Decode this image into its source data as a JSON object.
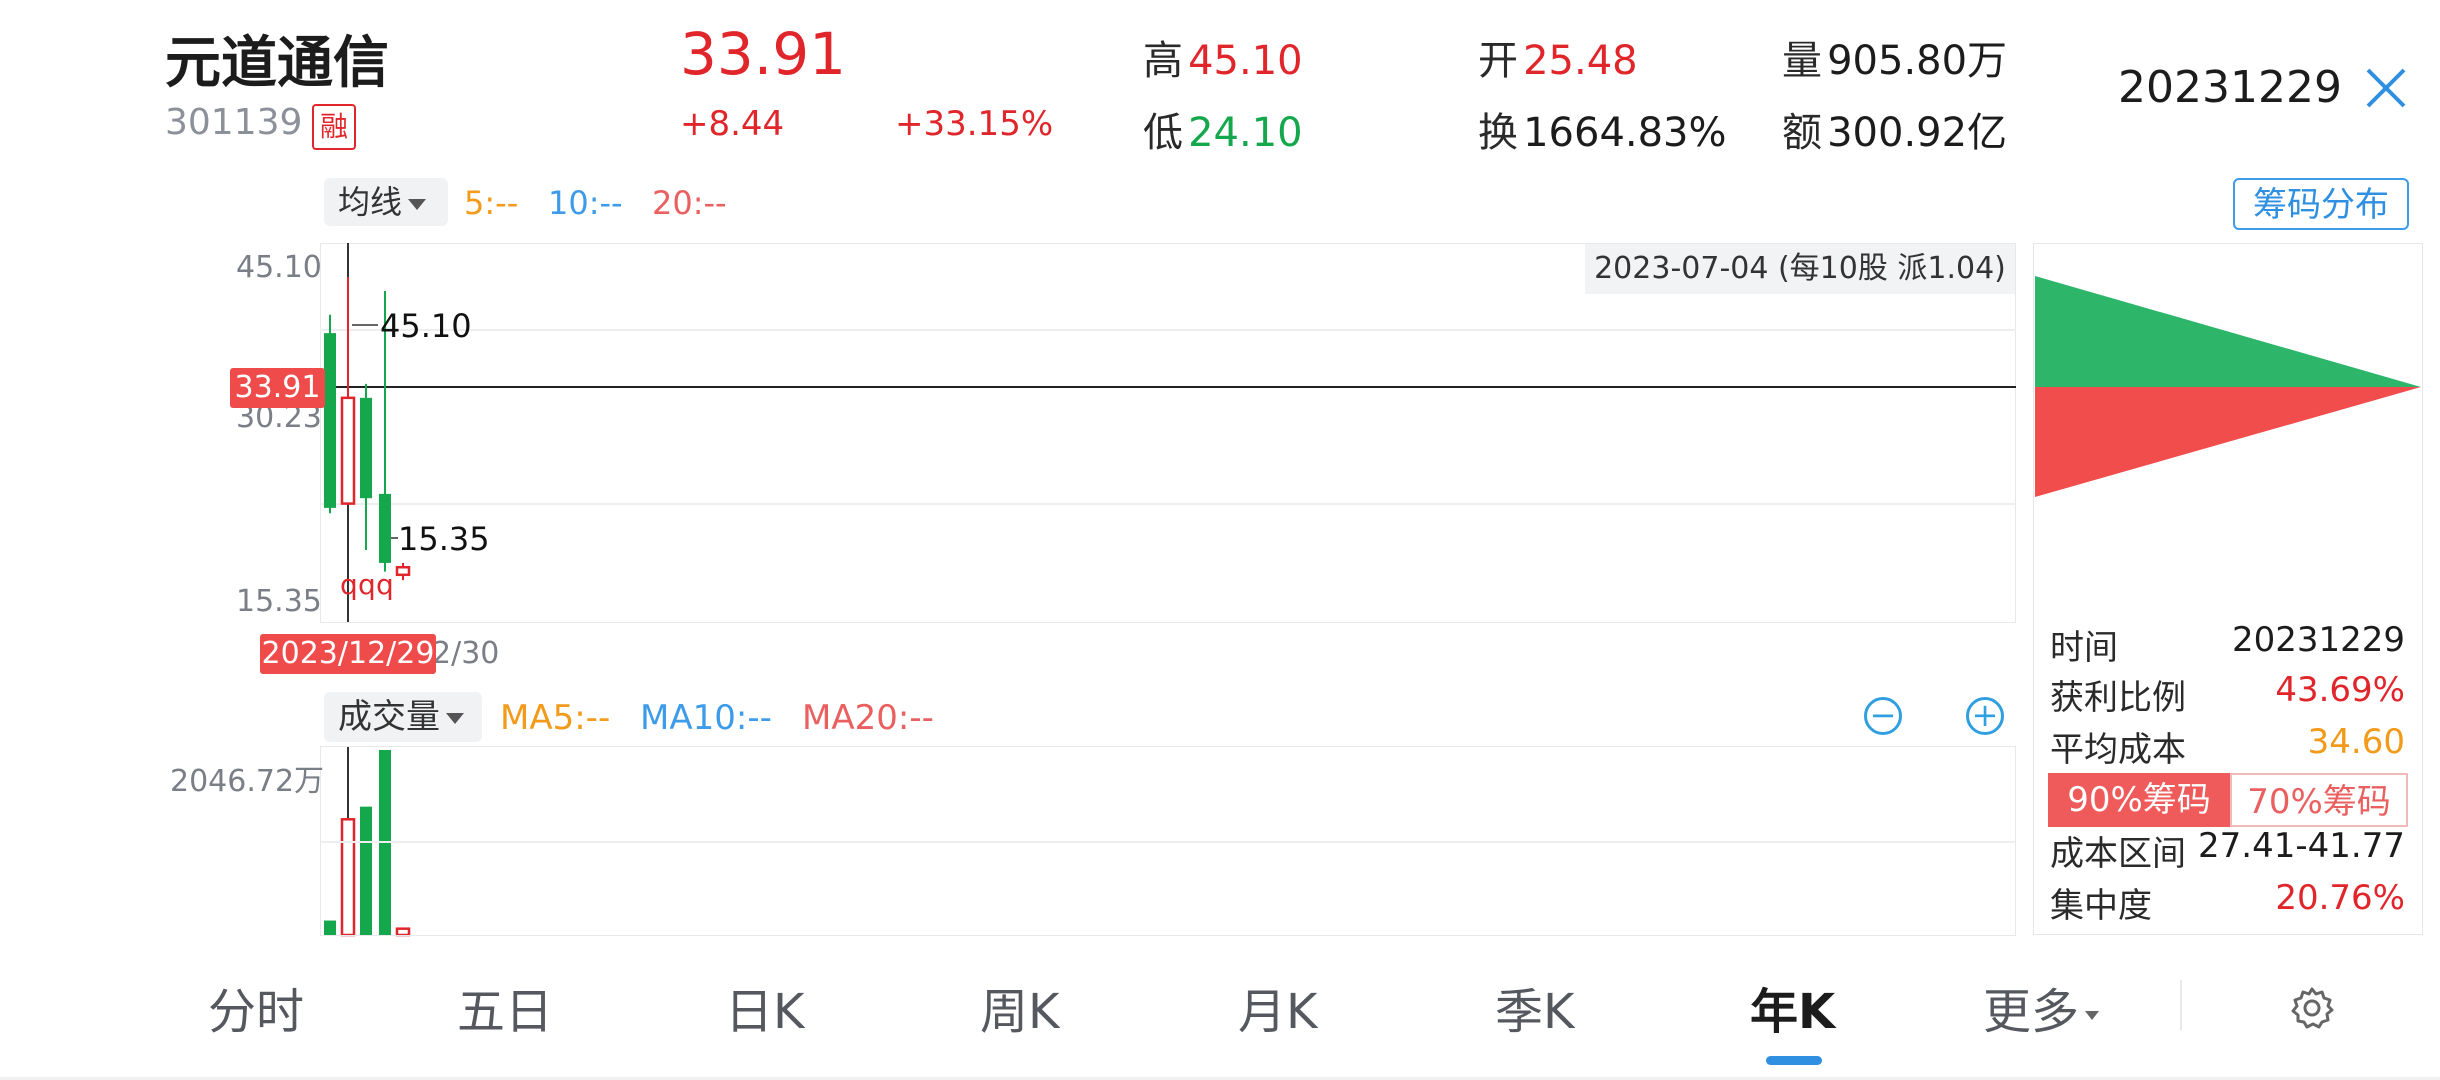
{
  "header": {
    "name": "元道通信",
    "code": "301139",
    "badge": "融",
    "price": "33.91",
    "change": "+8.44",
    "change_pct": "+33.15%",
    "high_label": "高",
    "high": "45.10",
    "low_label": "低",
    "low": "24.10",
    "open_label": "开",
    "open": "25.48",
    "turnover_label": "换",
    "turnover": "1664.83%",
    "volume_label": "量",
    "volume": "905.80万",
    "amount_label": "额",
    "amount": "300.92亿",
    "date": "20231229"
  },
  "ma_bar": {
    "selector": "均线",
    "ma5": "5:--",
    "ma10": "10:--",
    "ma20": "20:--",
    "chip_button": "筹码分布"
  },
  "main_chart": {
    "y_high": "45.10",
    "y_mid": "30.23",
    "y_low": "15.35",
    "current_price_tag": "33.91",
    "high_annotation": "45.10",
    "low_annotation": "15.35",
    "dividend_tag": "2023-07-04 (每10股 派1.04)",
    "event_marks": [
      "q",
      "q",
      "q"
    ],
    "crosshair_date": "2023/12/29",
    "x_label_partial": "2/30"
  },
  "volume_bar": {
    "selector": "成交量",
    "ma5": "MA5:--",
    "ma10": "MA10:--",
    "ma20": "MA20:--",
    "max_label": "2046.72万",
    "zoom_out": "−",
    "zoom_in": "+"
  },
  "chip_panel": {
    "time_label": "时间",
    "time_value": "20231229",
    "profit_label": "获利比例",
    "profit_value": "43.69%",
    "avg_cost_label": "平均成本",
    "avg_cost_value": "34.60",
    "tab_90": "90%筹码",
    "tab_70": "70%筹码",
    "range_label": "成本区间",
    "range_value": "27.41-41.77",
    "concentration_label": "集中度",
    "concentration_value": "20.76%"
  },
  "bottom_nav": {
    "items": [
      "分时",
      "五日",
      "日K",
      "周K",
      "月K",
      "季K",
      "年K",
      "更多"
    ],
    "active": "年K"
  },
  "chart_data": {
    "type": "candlestick",
    "candles": [
      {
        "open": 23.7,
        "close": 39.9,
        "high": 41.6,
        "low": 23.2,
        "color": "green"
      },
      {
        "open": 24.1,
        "close": 33.9,
        "high": 45.1,
        "low": 24.1,
        "color": "red"
      },
      {
        "open": 33.9,
        "close": 24.6,
        "high": 35.2,
        "low": 19.8,
        "color": "green"
      },
      {
        "open": 25.0,
        "close": 18.6,
        "high": 43.8,
        "low": 17.8,
        "color": "green"
      },
      {
        "open": 17.5,
        "close": 18.2,
        "high": 18.6,
        "low": 17.0,
        "color": "red"
      }
    ],
    "volumes_wan": [
      160,
      1280,
      1420,
      2046.72,
      70
    ],
    "ylim": [
      15.35,
      45.1
    ],
    "chip_distribution": {
      "profit_color": "#2db56a",
      "loss_color": "#f24d4d",
      "peak_price": 33.91
    }
  }
}
